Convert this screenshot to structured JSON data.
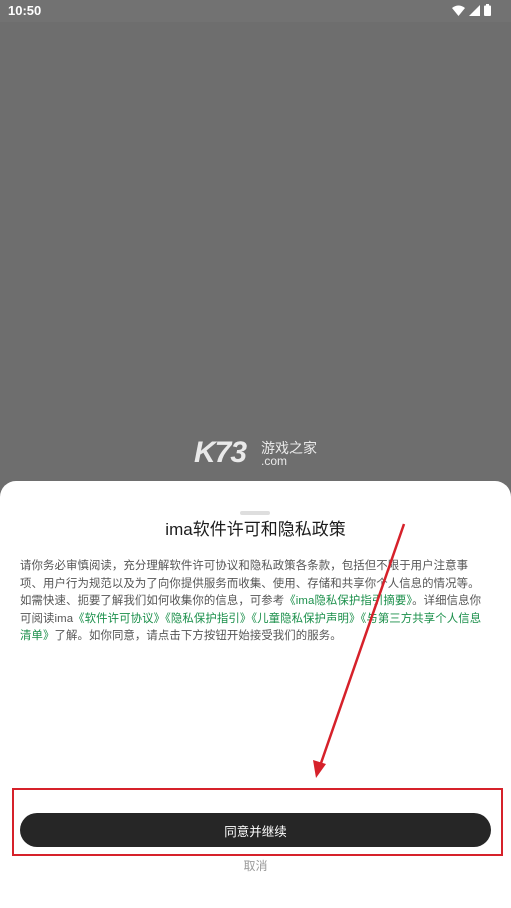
{
  "status_bar": {
    "time": "10:50"
  },
  "watermark": {
    "logo": "K73",
    "site_name": "游戏之家",
    "domain": ".com"
  },
  "dialog": {
    "title": "ima软件许可和隐私政策",
    "body": {
      "p1": "请你务必审慎阅读，充分理解软件许可协议和隐私政策各条款，包括但不限于用户注意事项、用户行为规范以及为了向你提供服务而收集、使用、存储和共享你个人信息的情况等。如需快速、扼要了解我们如何收集你的信息，可参考",
      "link1": "《ima隐私保护指引摘要》",
      "p2": "。详细信息你可阅读ima",
      "link2": "《软件许可协议》",
      "link3": "《隐私保护指引》",
      "link4": "《儿童隐私保护声明》",
      "link5": "《与第三方共享个人信息清单》",
      "p3": "了解。如你同意，请点击下方按钮开始接受我们的服务。"
    },
    "agree_label": "同意并继续",
    "cancel_label": "取消"
  },
  "annotation": {
    "highlight_color": "#d6212a",
    "arrow_color": "#d6212a"
  }
}
